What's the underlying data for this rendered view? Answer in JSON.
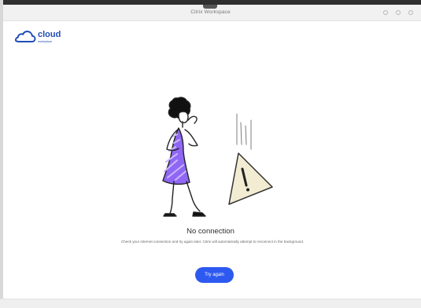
{
  "window": {
    "title": "Citrix Workspace"
  },
  "brand": {
    "name": "cloud",
    "subtitle": "workplace",
    "icon": "cloud-icon",
    "accent": "#2d59f0",
    "logo_color": "#1f4db8"
  },
  "status": {
    "headline": "No connection",
    "message": "Check your internet connection and try again later. Citrix will automatically attempt to reconnect in the background.",
    "illustration": "woman-warning-illustration"
  },
  "actions": {
    "retry_label": "Try again"
  },
  "colors": {
    "dress": "#8f67f4",
    "warning_fill": "#f2ecd2",
    "warning_outline": "#333333",
    "background": "#ffffff"
  }
}
